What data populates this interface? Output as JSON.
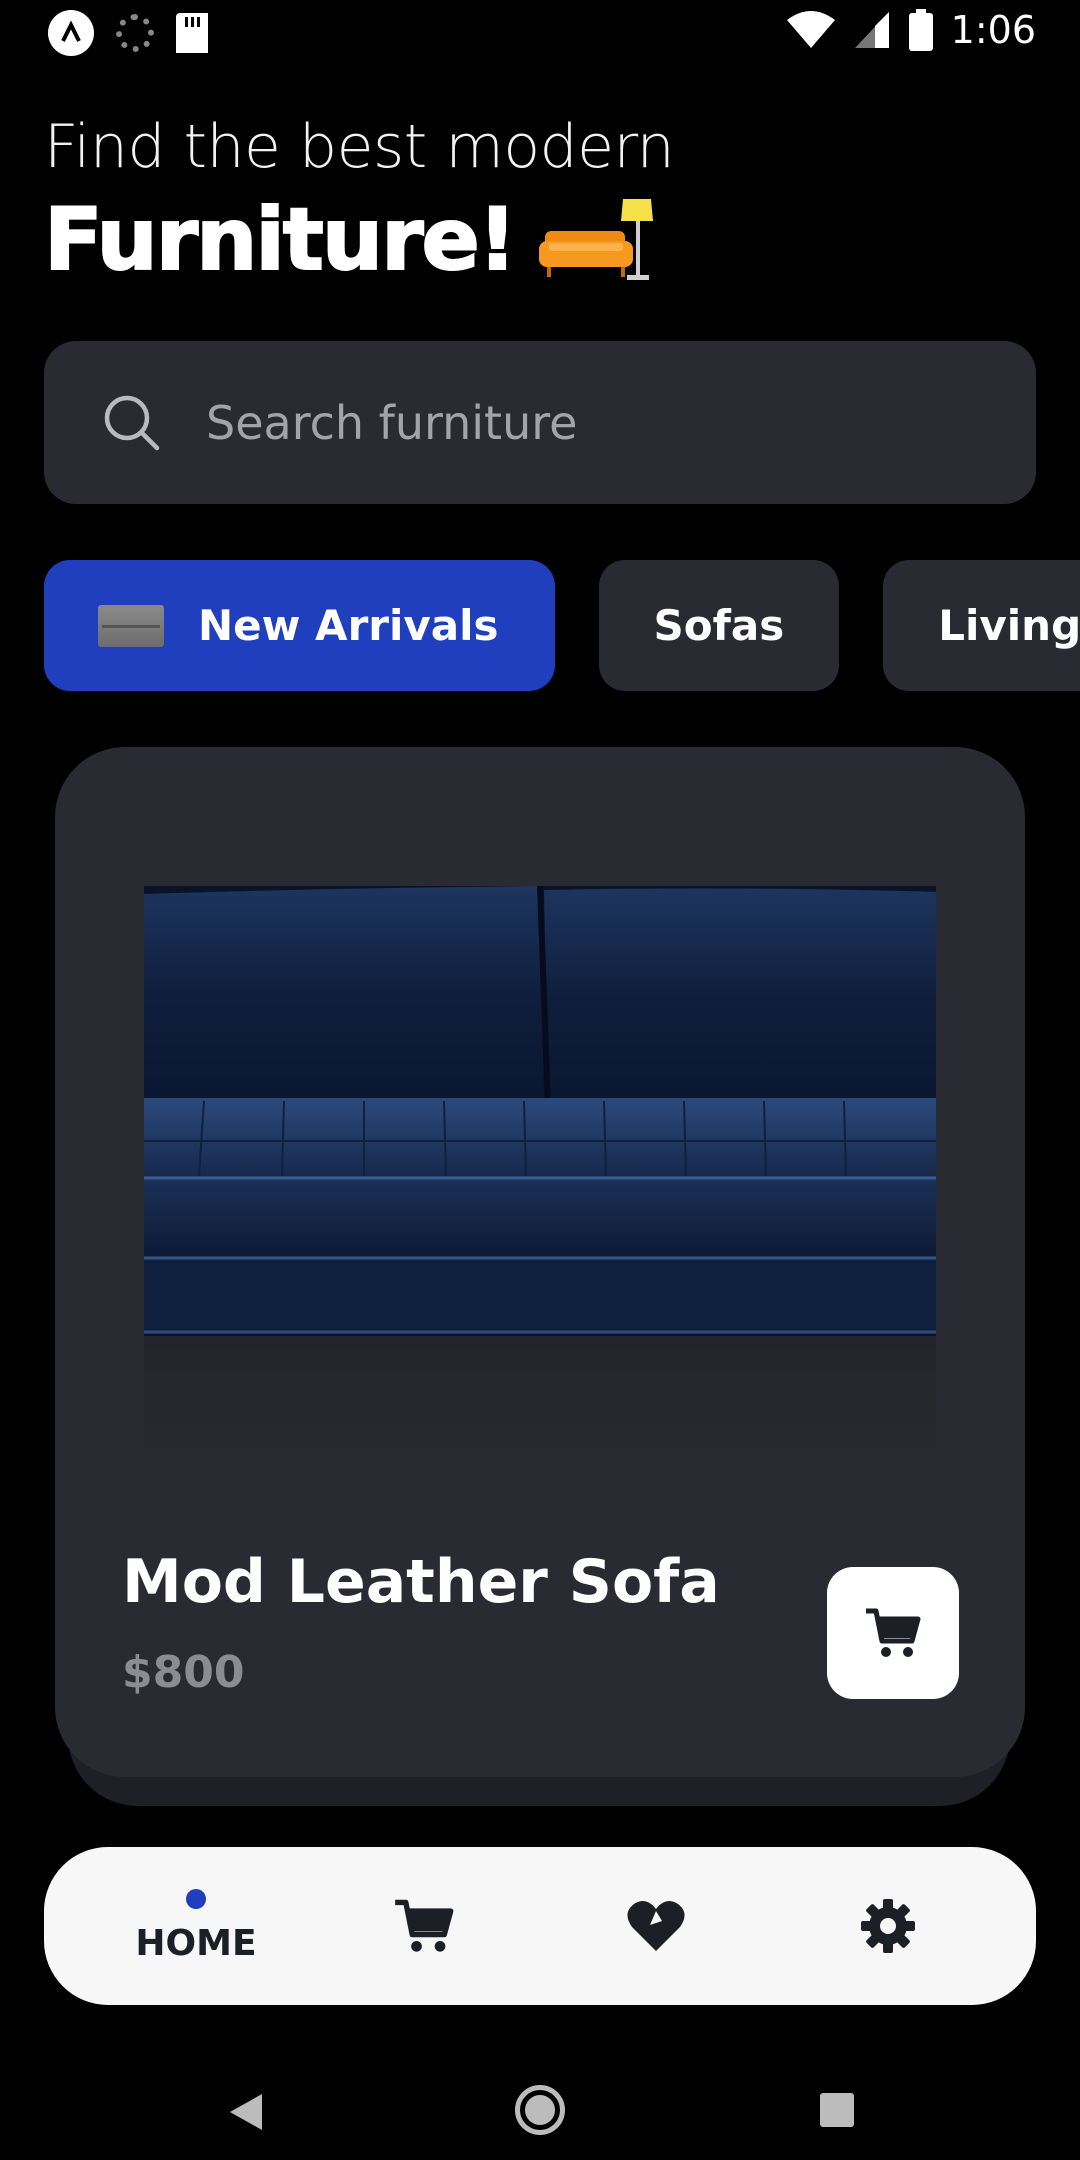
{
  "status_bar": {
    "time": "1:06",
    "icons": [
      "app-notification-icon",
      "loading-icon",
      "sd-card-icon",
      "wifi-icon",
      "cell-signal-icon",
      "battery-icon"
    ]
  },
  "header": {
    "subtitle": "Find the best modern",
    "title": "Furniture!",
    "title_icon": "sofa-lamp-icon"
  },
  "search": {
    "placeholder": "Search furniture",
    "value": ""
  },
  "categories": [
    {
      "label": "New Arrivals",
      "active": true,
      "icon": "sofa-thumbnail"
    },
    {
      "label": "Sofas",
      "active": false
    },
    {
      "label": "Living Room",
      "active": false
    }
  ],
  "product": {
    "name": "Mod Leather Sofa",
    "price": "$800",
    "image": "navy-velvet-sofa"
  },
  "bottom_nav": {
    "items": [
      {
        "label": "HOME",
        "icon": "home",
        "active": true
      },
      {
        "label": "",
        "icon": "cart-icon"
      },
      {
        "label": "",
        "icon": "heart-icon"
      },
      {
        "label": "",
        "icon": "gear-icon"
      }
    ]
  },
  "colors": {
    "background": "#000000",
    "surface": "#2a2b32",
    "accent": "#1f3fbf",
    "price": "#8b8c95",
    "nav_background": "#f7f7f8"
  }
}
